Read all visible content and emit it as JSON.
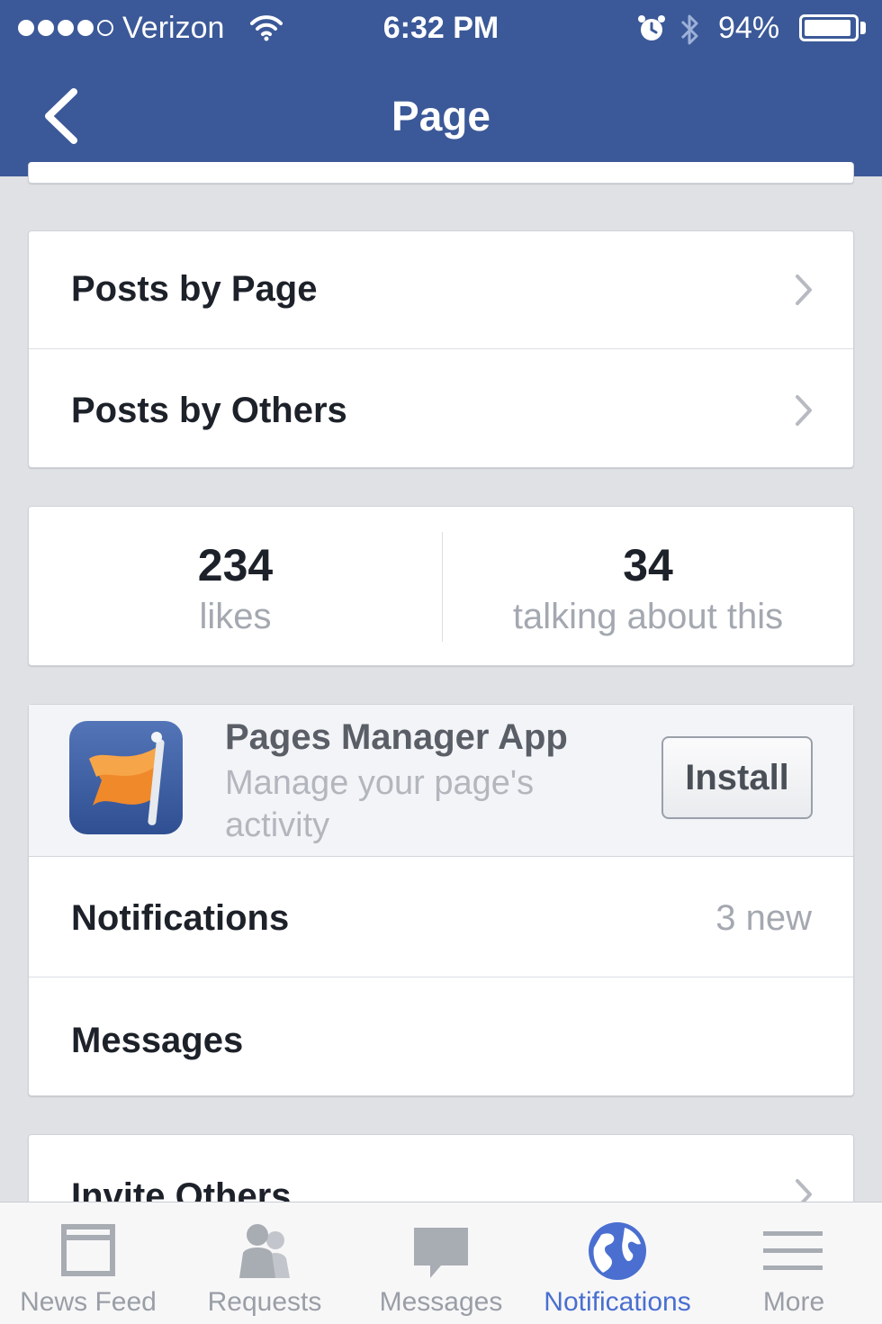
{
  "status_bar": {
    "carrier": "Verizon",
    "time": "6:32 PM",
    "battery": "94%",
    "battery_level": 0.94
  },
  "nav": {
    "title": "Page"
  },
  "posts_card": {
    "items": [
      {
        "label": "Posts by Page"
      },
      {
        "label": "Posts by Others"
      }
    ]
  },
  "stats": {
    "likes_count": "234",
    "likes_label": "likes",
    "talking_count": "34",
    "talking_label": "talking about this"
  },
  "promo": {
    "title": "Pages Manager App",
    "description": "Manage your page's activity",
    "button_label": "Install",
    "icon": "flag-icon"
  },
  "manage_card": {
    "notifications_label": "Notifications",
    "notifications_value": "3 new",
    "messages_label": "Messages"
  },
  "invite_card": {
    "label": "Invite Others"
  },
  "tab_bar": {
    "items": [
      {
        "label": "News Feed",
        "icon": "news-feed-icon"
      },
      {
        "label": "Requests",
        "icon": "requests-icon"
      },
      {
        "label": "Messages",
        "icon": "messages-icon"
      },
      {
        "label": "Notifications",
        "icon": "globe-icon",
        "active": true
      },
      {
        "label": "More",
        "icon": "menu-icon"
      }
    ]
  },
  "colors": {
    "brand_blue": "#3b5998",
    "active_tab": "#4a6fd0",
    "background": "#dfe1e5"
  }
}
